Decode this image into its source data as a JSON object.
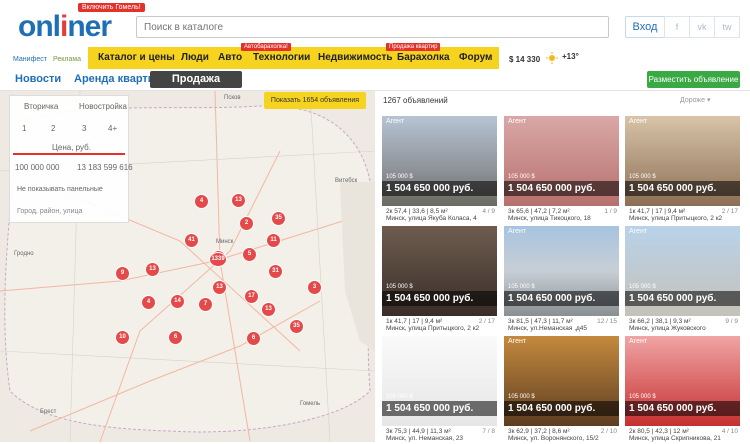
{
  "header": {
    "logo_text_1": "onl",
    "logo_text_2": "i",
    "logo_text_3": "ner",
    "promo": "Включить Гомель!",
    "search_placeholder": "Поиск в каталоге",
    "login": "Вход",
    "social": [
      "f",
      "vk",
      "tw"
    ]
  },
  "topnav": {
    "small_links": [
      "Манифест",
      "Реклама"
    ],
    "items": [
      "Каталог и цены",
      "Люди",
      "Авто",
      "Технологии",
      "Недвижимость",
      "Барахолка",
      "Форум"
    ],
    "tags": [
      "Автобарахолка!",
      "Продажа квартир"
    ],
    "usd": "$ 14 330",
    "weather": "+13°"
  },
  "subnav": {
    "tabs": [
      "Новости",
      "Аренда квартир"
    ],
    "active_tab": "Продажа квартир",
    "place_button": "Разместить объявление"
  },
  "map": {
    "show_button": "Показать 1654 объявления",
    "filter": {
      "types": [
        "Вторичка",
        "Новостройка"
      ],
      "rooms": [
        "1",
        "2",
        "3",
        "4+"
      ],
      "price_label": "Цена, руб.",
      "price_min": "100 000 000",
      "price_max": "13 183 599 616",
      "no_panel": "Не показывать панельные",
      "city_placeholder": "Город, район, улица"
    },
    "pins": [
      "13",
      "4",
      "2",
      "35",
      "41",
      "11",
      "13",
      "1339",
      "5",
      "9",
      "13",
      "31",
      "17",
      "4",
      "14",
      "7",
      "13",
      "13",
      "3",
      "10",
      "6",
      "6",
      "35"
    ],
    "cities": [
      "Псков",
      "Витебск",
      "Минск",
      "Брест",
      "Гомель",
      "Гродно"
    ]
  },
  "listing": {
    "count": "1267 объявлений",
    "sort": "Дороже",
    "cards": [
      {
        "agent": "Агент",
        "usd": "105 000 $",
        "price": "1 504 650 000 руб.",
        "info": "2к 57,4 | 33,6 | 8,5 м²",
        "floor": "4 / 9",
        "addr": "Минск, улица Якуба Коласа, 4"
      },
      {
        "agent": "Агент",
        "usd": "105 000 $",
        "price": "1 504 650 000 руб.",
        "info": "3к 65,6 | 47,2 | 7,2 м²",
        "floor": "1 / 9",
        "addr": "Минск, улица Тикоцкого, 18"
      },
      {
        "agent": "Агент",
        "usd": "105 000 $",
        "price": "1 504 650 000 руб.",
        "info": "1к 41,7 | 17 | 9,4 м²",
        "floor": "2 / 17",
        "addr": "Минск, улица Притыцкого, 2 к2"
      },
      {
        "agent": "",
        "usd": "105 000 $",
        "price": "1 504 650 000 руб.",
        "info": "1к 41,7 | 17 | 9,4 м²",
        "floor": "2 / 17",
        "addr": "Минск, улица Притыцкого, 2 к2"
      },
      {
        "agent": "Агент",
        "usd": "105 000 $",
        "price": "1 504 650 000 руб.",
        "info": "3к 81,5 | 47,3 | 11,7 м²",
        "floor": "12 / 15",
        "addr": "Минск, ул.Неманская ,д45"
      },
      {
        "agent": "Агент",
        "usd": "105 000 $",
        "price": "1 504 650 000 руб.",
        "info": "3к 66,2 | 38,1 | 9,3 м²",
        "floor": "9 / 9",
        "addr": "Минск, улица Жуковского"
      },
      {
        "agent": "",
        "usd": "105 000 $",
        "price": "1 504 650 000 руб.",
        "info": "3к 75,3 | 44,9 | 11,3 м²",
        "floor": "7 / 8",
        "addr": "Минск, ул. Неманская, 23"
      },
      {
        "agent": "Агент",
        "usd": "105 000 $",
        "price": "1 504 650 000 руб.",
        "info": "3к 62,9 | 37,2 | 8,6 м²",
        "floor": "2 / 10",
        "addr": "Минск, ул. Воронянского, 15/2"
      },
      {
        "agent": "Агент",
        "usd": "105 000 $",
        "price": "1 504 650 000 руб.",
        "info": "2к 80,5 | 42,3 | 12 м²",
        "floor": "4 / 10",
        "addr": "Минск, улица Скрипникова, 21"
      }
    ]
  }
}
